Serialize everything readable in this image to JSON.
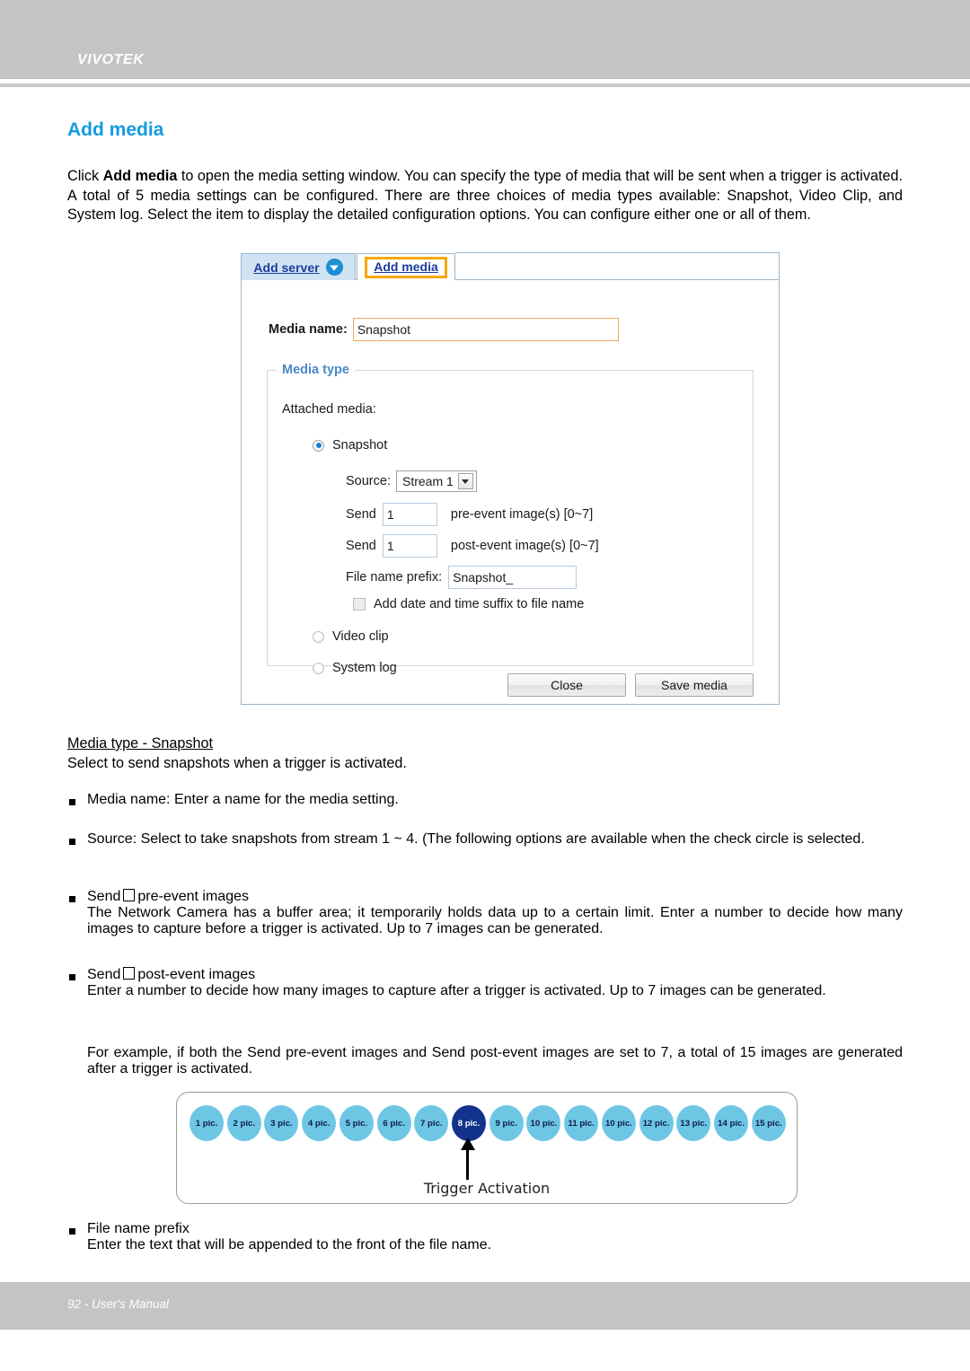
{
  "header": {
    "brand": "VIVOTEK"
  },
  "page": {
    "title": "Add media",
    "intro_pre": "Click ",
    "intro_bold": "Add media",
    "intro_post": " to open the media setting window. You can specify the type of media that will be sent when a trigger is activated. A total of 5 media settings can be configured. There are three choices of media types available: Snapshot, Video Clip, and System log. Select the item to display the detailed configuration options. You can configure either one or all of them."
  },
  "dialog": {
    "tabs": [
      {
        "label": "Add server",
        "icon": "chevron-down-circle-icon",
        "active": false
      },
      {
        "label": "Add media",
        "active": true
      }
    ],
    "media_name_label": "Media name:",
    "media_name_value": "Snapshot",
    "fieldset_legend": "Media type",
    "attached_media_label": "Attached media:",
    "options": {
      "snapshot": "Snapshot",
      "video_clip": "Video clip",
      "system_log": "System log"
    },
    "source_label": "Source:",
    "source_value": "Stream 1",
    "send_label": "Send",
    "pre_event_value": "1",
    "pre_event_suffix": "pre-event image(s) [0~7]",
    "post_event_value": "1",
    "post_event_suffix": "post-event image(s) [0~7]",
    "file_prefix_label": "File name prefix:",
    "file_prefix_value": "Snapshot_",
    "date_suffix_label": "Add date and time suffix to file name",
    "buttons": {
      "close": "Close",
      "save": "Save media"
    }
  },
  "sections": {
    "media_type_heading": "Media type - Snapshot ",
    "media_type_desc": "Select to send snapshots when a trigger is activated.",
    "bullet_media_name": "Media name: Enter a name for the media setting.",
    "bullet_source": "Source: Select to take snapshots from stream 1 ~ 4. (The following options are available when the check circle is selected.",
    "bullet_send_pre_a": "Send",
    "bullet_send_pre_b": "pre-event images",
    "send_pre_body": "The Network Camera has a buffer area; it temporarily holds data up to a certain limit. Enter a number to decide how many images to capture before a trigger is activated. Up to 7 images can be generated.",
    "bullet_send_post_a": "Send",
    "bullet_send_post_b": "post-event images",
    "send_post_body": "Enter a number to decide how many images to capture after a trigger is activated. Up to 7 images can be generated.",
    "example_body": "For example, if both the Send pre-event images and Send post-event images are set to 7, a total of 15 images are generated after a trigger is activated.",
    "bullet_file_prefix": "File name prefix",
    "file_prefix_body": "Enter the text that will be appended to the front of the file name."
  },
  "timeline": {
    "pics": [
      {
        "label": "1 pic.",
        "trigger": false
      },
      {
        "label": "2 pic.",
        "trigger": false
      },
      {
        "label": "3 pic.",
        "trigger": false
      },
      {
        "label": "4 pic.",
        "trigger": false
      },
      {
        "label": "5 pic.",
        "trigger": false
      },
      {
        "label": "6 pic.",
        "trigger": false
      },
      {
        "label": "7 pic.",
        "trigger": false
      },
      {
        "label": "8 pic.",
        "trigger": true
      },
      {
        "label": "9 pic.",
        "trigger": false
      },
      {
        "label": "10 pic.",
        "trigger": false
      },
      {
        "label": "11 pic.",
        "trigger": false
      },
      {
        "label": "10 pic.",
        "trigger": false
      },
      {
        "label": "12 pic.",
        "trigger": false
      },
      {
        "label": "13 pic.",
        "trigger": false
      },
      {
        "label": "14 pic.",
        "trigger": false
      },
      {
        "label": "15 pic.",
        "trigger": false
      }
    ],
    "trigger_label": "Trigger Activation"
  },
  "footer": {
    "text": "92 - User's Manual"
  },
  "colors": {
    "header_gray": "#c2c5c4",
    "title_blue": "#149bdf",
    "legend_blue": "#4a88c7",
    "tab_highlight": "#f5a800",
    "pic_light": "#6dc6e4",
    "pic_trigger": "#12328c"
  }
}
